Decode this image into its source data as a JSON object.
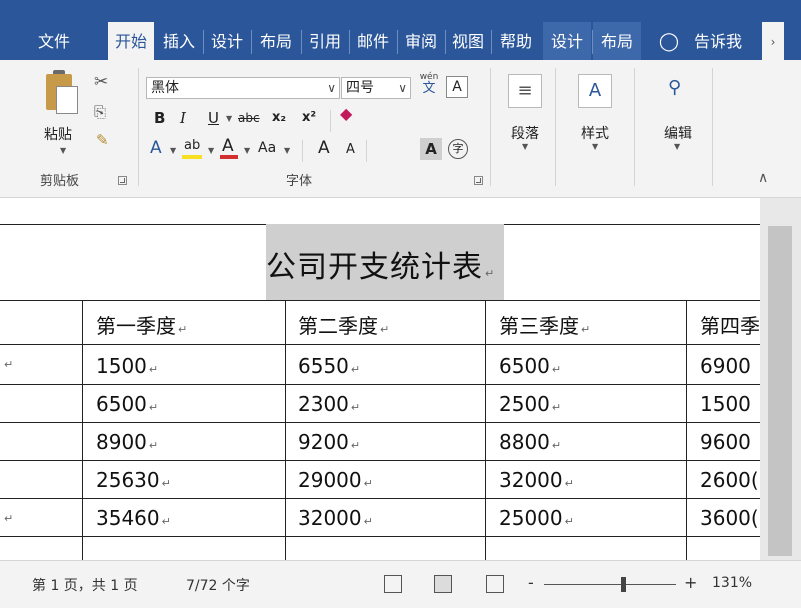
{
  "tabs": [
    {
      "label": "文件",
      "state": "normal"
    },
    {
      "label": "开始",
      "state": "active"
    },
    {
      "label": "插入",
      "state": "normal"
    },
    {
      "label": "设计",
      "state": "normal"
    },
    {
      "label": "布局",
      "state": "normal"
    },
    {
      "label": "引用",
      "state": "normal"
    },
    {
      "label": "邮件",
      "state": "normal"
    },
    {
      "label": "审阅",
      "state": "normal"
    },
    {
      "label": "视图",
      "state": "normal"
    },
    {
      "label": "帮助",
      "state": "normal"
    },
    {
      "label": "设计",
      "state": "contextual"
    },
    {
      "label": "布局",
      "state": "contextual"
    }
  ],
  "tell_me": {
    "label": "告诉我",
    "icon": "lightbulb-icon"
  },
  "ribbon": {
    "clipboard": {
      "paste_label": "粘贴",
      "group_label": "剪贴板"
    },
    "font": {
      "font_name": "黑体",
      "font_size": "四号",
      "group_label": "字体",
      "phonetic_top": "wén",
      "phonetic_bottom": "文",
      "border_char": "A",
      "bold": "B",
      "italic": "I",
      "underline": "U",
      "strikethrough": "abc",
      "subscript": "x₂",
      "superscript": "x²",
      "text_effects": "A",
      "highlight": "ab",
      "font_color": "A",
      "change_case": "Aa",
      "grow_font": "A",
      "shrink_font": "A",
      "char_shading": "A",
      "enclose_char": "字"
    },
    "paragraph": {
      "label": "段落"
    },
    "styles": {
      "label": "样式"
    },
    "editing": {
      "label": "编辑"
    }
  },
  "document": {
    "title": "公司开支统计表",
    "headers": [
      "第一季度",
      "第二季度",
      "第三季度",
      "第四季"
    ],
    "rows": [
      [
        "1500",
        "6550",
        "6500",
        "6900"
      ],
      [
        "6500",
        "2300",
        "2500",
        "1500"
      ],
      [
        "8900",
        "9200",
        "8800",
        "9600"
      ],
      [
        "25630",
        "29000",
        "32000",
        "2600("
      ],
      [
        "35460",
        "32000",
        "25000",
        "3600("
      ]
    ],
    "paragraph_mark": "↵"
  },
  "statusbar": {
    "page": "第 1 页，共 1 页",
    "words": "7/72 个字",
    "zoom_minus": "-",
    "zoom_plus": "+",
    "zoom": "131%",
    "zoom_level_percent": 131
  },
  "colors": {
    "accent": "#2b579a",
    "ribbon_bg": "#f3f3f3",
    "highlight_gray": "#cfcfcf"
  }
}
